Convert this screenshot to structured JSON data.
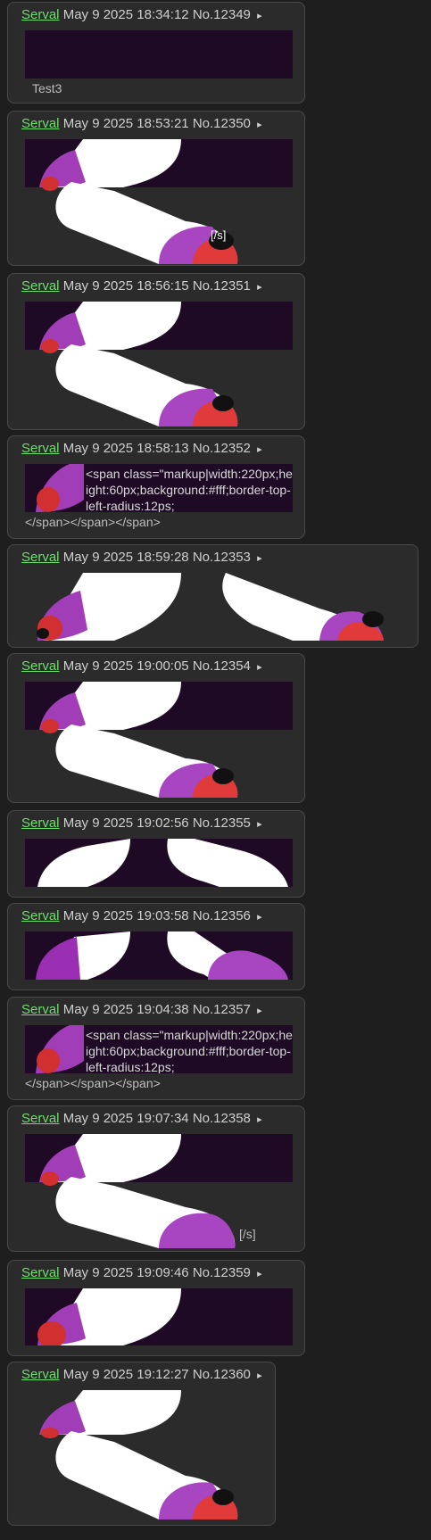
{
  "posts": [
    {
      "name": "Serval",
      "date": "May 9 2025 18:34:12",
      "no": "No.12349",
      "arrow": "▸",
      "text": "Test3"
    },
    {
      "name": "Serval",
      "date": "May 9 2025 18:53:21",
      "no": "No.12350",
      "arrow": "▸",
      "tag": "[/s]"
    },
    {
      "name": "Serval",
      "date": "May 9 2025 18:56:15",
      "no": "No.12351",
      "arrow": "▸"
    },
    {
      "name": "Serval",
      "date": "May 9 2025 18:58:13",
      "no": "No.12352",
      "arrow": "▸",
      "markup": "<span class=\"markup|width:220px;height:60px;background:#fff;border-top-left-radius:12ps;",
      "tail": "</span></span></span>"
    },
    {
      "name": "Serval",
      "date": "May 9 2025 18:59:28",
      "no": "No.12353",
      "arrow": "▸"
    },
    {
      "name": "Serval",
      "date": "May 9 2025 19:00:05",
      "no": "No.12354",
      "arrow": "▸"
    },
    {
      "name": "Serval",
      "date": "May 9 2025 19:02:56",
      "no": "No.12355",
      "arrow": "▸"
    },
    {
      "name": "Serval",
      "date": "May 9 2025 19:03:58",
      "no": "No.12356",
      "arrow": "▸"
    },
    {
      "name": "Serval",
      "date": "May 9 2025 19:04:38",
      "no": "No.12357",
      "arrow": "▸",
      "markup": "<span class=\"markup|width:220px;height:60px;background:#fff;border-top-left-radius:12ps;",
      "tail": "</span></span></span>"
    },
    {
      "name": "Serval",
      "date": "May 9 2025 19:07:34",
      "no": "No.12358",
      "arrow": "▸",
      "tag": "[/s]"
    },
    {
      "name": "Serval",
      "date": "May 9 2025 19:09:46",
      "no": "No.12359",
      "arrow": "▸"
    },
    {
      "name": "Serval",
      "date": "May 9 2025 19:12:27",
      "no": "No.12360",
      "arrow": "▸"
    }
  ],
  "colors": {
    "name": "#6fdc6f",
    "purple": "#a846c2",
    "red": "#e03a3a",
    "dark": "#1e0a24"
  }
}
